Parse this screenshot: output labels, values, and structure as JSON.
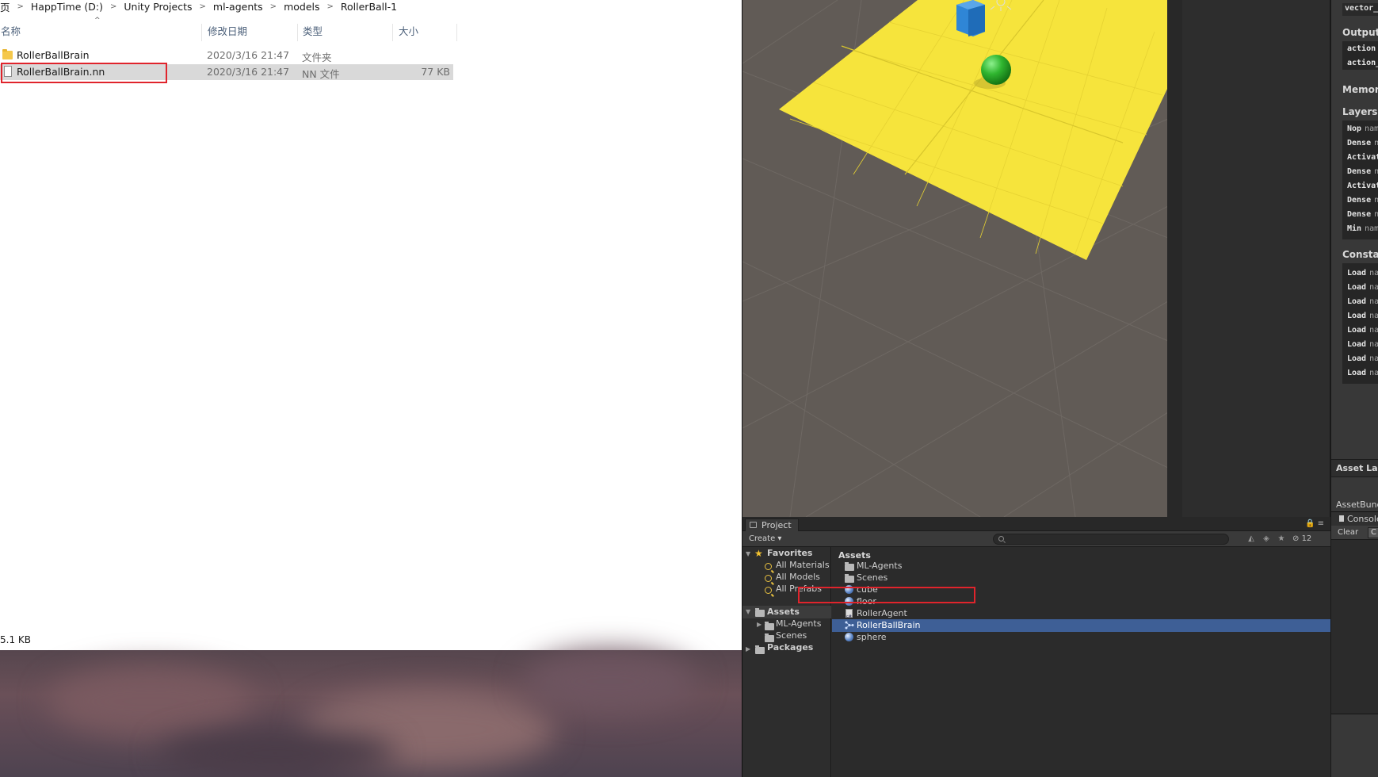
{
  "explorer": {
    "breadcrumb": [
      "页",
      "HappTime (D:)",
      "Unity Projects",
      "ml-agents",
      "models",
      "RollerBall-1"
    ],
    "columns": {
      "name": "名称",
      "modified": "修改日期",
      "type": "类型",
      "size": "大小"
    },
    "files": [
      {
        "name": "RollerBallBrain",
        "modified": "2020/3/16 21:47",
        "type": "文件夹",
        "size": "",
        "icon": "folder-icon",
        "selected": false
      },
      {
        "name": "RollerBallBrain.nn",
        "modified": "2020/3/16 21:47",
        "type": "NN 文件",
        "size": "77 KB",
        "icon": "file-icon",
        "selected": true
      }
    ],
    "status_size": "5.1 KB",
    "highlight_color": "#e0242c"
  },
  "scene": {
    "ground_color": "#615b56",
    "plane_color": "#f6e43c",
    "cube_color": "#2f86d6",
    "sphere_color": "#2fb52f"
  },
  "inspector": {
    "field_top": "vector_obs",
    "output_heading": "Output",
    "outputs": [
      "action",
      "action_p"
    ],
    "memories_heading": "Memories",
    "layers_heading": "Layers",
    "layers": [
      {
        "label": "Nop",
        "suffix": "nam"
      },
      {
        "label": "Dense",
        "suffix": "n"
      },
      {
        "label": "Activati",
        "suffix": ""
      },
      {
        "label": "Dense",
        "suffix": "n"
      },
      {
        "label": "Activati",
        "suffix": ""
      },
      {
        "label": "Dense",
        "suffix": "n"
      },
      {
        "label": "Dense",
        "suffix": "n"
      },
      {
        "label": "Min",
        "suffix": "nam"
      }
    ],
    "constants_heading": "Constants",
    "constants": [
      "Load",
      "Load",
      "Load",
      "Load",
      "Load",
      "Load",
      "Load",
      "Load"
    ],
    "constants_suffix": "na",
    "asset_labels": "Asset Labels",
    "asset_bundle": "AssetBundle",
    "console_tab": "Console",
    "clear_button": "Clear",
    "collapse_button": "C"
  },
  "project": {
    "tab_label": "Project",
    "create_label": "Create ▾",
    "hidden_count": "12",
    "favorites": {
      "label": "Favorites",
      "items": [
        "All Materials",
        "All Models",
        "All Prefabs"
      ]
    },
    "tree": {
      "assets_label": "Assets",
      "children": [
        "ML-Agents",
        "Scenes"
      ],
      "packages_label": "Packages"
    },
    "assets_header": "Assets",
    "assets": [
      {
        "name": "ML-Agents",
        "icon": "folder-icon",
        "selected": false
      },
      {
        "name": "Scenes",
        "icon": "folder-icon",
        "selected": false
      },
      {
        "name": "cube",
        "icon": "prefab-sphere-icon",
        "selected": false
      },
      {
        "name": "floor",
        "icon": "prefab-sphere-icon",
        "selected": false
      },
      {
        "name": "RollerAgent",
        "icon": "script-icon",
        "selected": false
      },
      {
        "name": "RollerBallBrain",
        "icon": "nn-model-icon",
        "selected": true
      },
      {
        "name": "sphere",
        "icon": "prefab-sphere-icon",
        "selected": false
      }
    ],
    "selection_color": "#3e5f96"
  }
}
